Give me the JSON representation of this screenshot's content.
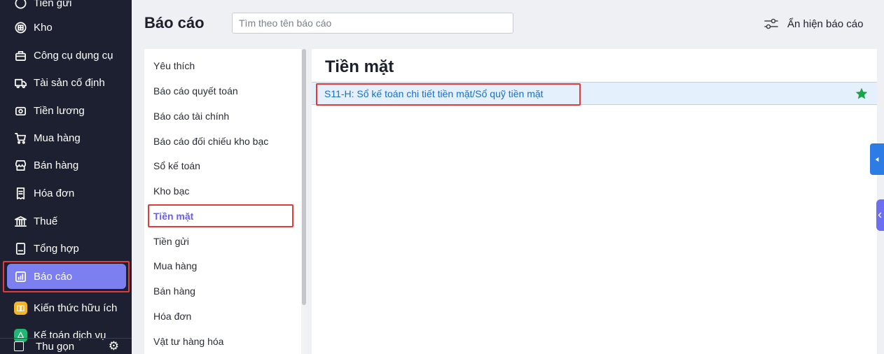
{
  "sidebar": {
    "partial_top": "Tiền gửi",
    "items": [
      {
        "label": "Kho",
        "icon": "warehouse-icon"
      },
      {
        "label": "Công cụ dụng cụ",
        "icon": "tools-icon"
      },
      {
        "label": "Tài sản cố định",
        "icon": "truck-icon"
      },
      {
        "label": "Tiền lương",
        "icon": "salary-icon"
      },
      {
        "label": "Mua hàng",
        "icon": "cart-icon"
      },
      {
        "label": "Bán hàng",
        "icon": "store-icon"
      },
      {
        "label": "Hóa đơn",
        "icon": "invoice-icon"
      },
      {
        "label": "Thuế",
        "icon": "bank-icon"
      },
      {
        "label": "Tổng hợp",
        "icon": "summary-icon"
      },
      {
        "label": "Báo cáo",
        "icon": "chart-icon",
        "active": true
      },
      {
        "label": "Kiến thức hữu ích",
        "icon": "book-icon"
      },
      {
        "label": "Kế toán dịch vụ",
        "icon": "service-icon"
      }
    ],
    "collapse_label": "Thu gọn"
  },
  "header": {
    "title": "Báo cáo",
    "search_placeholder": "Tìm theo tên báo cáo",
    "toggle_label": "Ẩn hiện báo cáo"
  },
  "categories": [
    "Yêu thích",
    "Báo cáo quyết toán",
    "Báo cáo tài chính",
    "Báo cáo đối chiếu kho bạc",
    "Sổ kế toán",
    "Kho bạc",
    "Tiền mặt",
    "Tiền gửi",
    "Mua hàng",
    "Bán hàng",
    "Hóa đơn",
    "Vật tư hàng hóa"
  ],
  "active_category": "Tiền mặt",
  "report_panel": {
    "title": "Tiền mặt",
    "reports": [
      {
        "label": "S11-H: Sổ kế toán chi tiết tiền mặt/Sổ quỹ tiền mặt",
        "favorite": true
      }
    ]
  },
  "colors": {
    "sidebar_bg": "#1d2030",
    "active_nav": "#7b7ff0",
    "highlight": "#e33b3b",
    "link": "#1b6fc6",
    "star": "#1aa34a"
  }
}
